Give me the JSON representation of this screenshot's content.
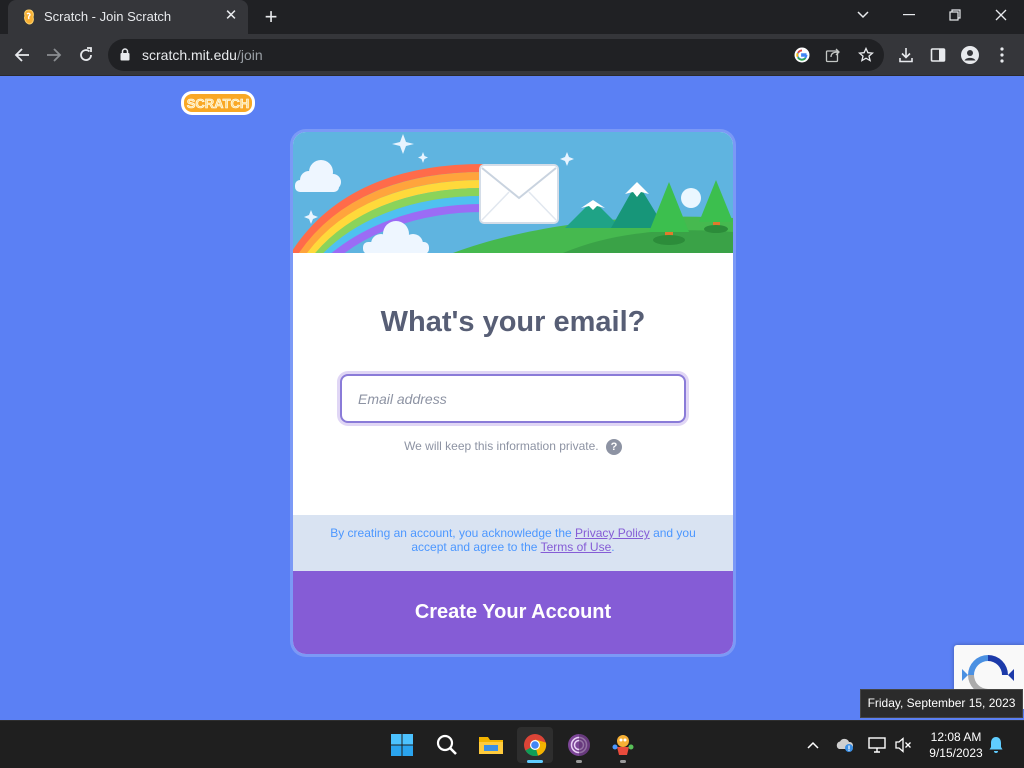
{
  "browser": {
    "tab": {
      "title": "Scratch - Join Scratch"
    },
    "url": {
      "host": "scratch.mit.edu",
      "path": "/join"
    }
  },
  "page": {
    "logo_text": "SCRATCH",
    "heading": "What's your email?",
    "email_placeholder": "Email address",
    "private_note": "We will keep this information private.",
    "help_glyph": "?",
    "legal": {
      "before": "By creating an account, you acknowledge the ",
      "privacy_link": "Privacy Policy",
      "middle": " and you accept and agree to the ",
      "terms_link": "Terms of Use",
      "after": "."
    },
    "create_button": "Create Your Account"
  },
  "tooltip": {
    "date": "Friday, September 15, 2023"
  },
  "taskbar": {
    "apps": [
      "start-icon",
      "search-icon",
      "file-explorer-icon",
      "chrome-icon",
      "tor-browser-icon",
      "scratch-app-icon"
    ],
    "clock": {
      "time": "12:08 AM",
      "date": "9/15/2023"
    }
  },
  "colors": {
    "page_bg": "#5b80f4",
    "heading": "#575e75",
    "button": "#855cd6",
    "legal_bg": "#d9e3f2",
    "legal_text": "#4c97ff"
  }
}
